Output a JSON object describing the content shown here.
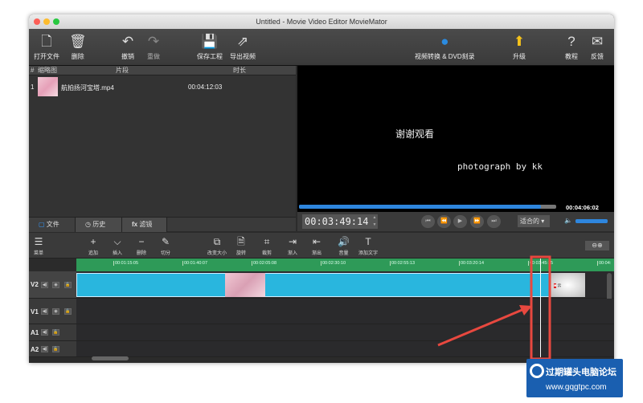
{
  "window": {
    "title": "Untitled - Movie Video Editor MovieMator"
  },
  "toolbar": {
    "open": "打开文件",
    "delete": "删除",
    "undo": "撤销",
    "redo": "重做",
    "save": "保存工程",
    "export": "导出视频",
    "convert": "视频转换 & DVD刻录",
    "upgrade": "升级",
    "tutorial": "教程",
    "feedback": "反馈"
  },
  "media": {
    "headers": [
      "#",
      "缩略图",
      "片段",
      "时长"
    ],
    "rows": [
      {
        "index": "1",
        "name": "航拍扬河宝塔.mp4",
        "duration": "00:04:12:03"
      }
    ],
    "tabs": [
      "文件",
      "历史",
      "滤镜"
    ],
    "tab_icons": [
      "file-icon",
      "history-icon",
      "fx-icon"
    ]
  },
  "preview": {
    "line1": "谢谢观看",
    "line2": "photograph by kk",
    "progress": 0.94,
    "total": "00:04:06:02",
    "current": "00:03:49:14",
    "zoom": "适合的",
    "volume": 1.0
  },
  "timeline": {
    "tools": [
      "菜单",
      "追加",
      "插入",
      "删除",
      "切分",
      "改变大小",
      "旋转",
      "裁剪",
      "渐入",
      "渐出",
      "音量",
      "添加文字"
    ],
    "ruler": [
      "00:01:15:05",
      "00:01:40:07",
      "00:02:05:08",
      "00:02:30:10",
      "00:02:55:13",
      "00:03:20:14",
      "00:03:45:15",
      "00:04:"
    ],
    "tracks": [
      "V2",
      "V1",
      "A1",
      "A2"
    ],
    "colors": {
      "clip": "#29b6de",
      "ruler": "#2e9a58",
      "highlight": "#e8483f"
    }
  },
  "watermark": {
    "text": "过期罐头电脑论坛",
    "url": "www.gqgtpc.com"
  }
}
